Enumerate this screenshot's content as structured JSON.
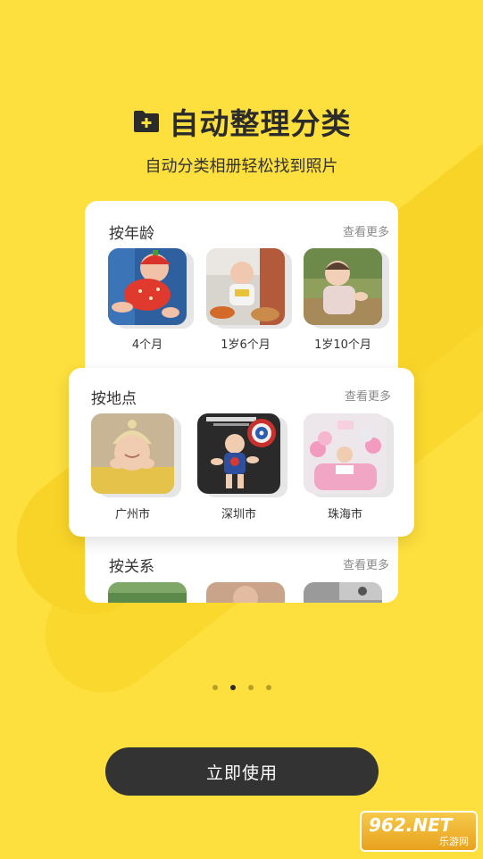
{
  "header": {
    "title": "自动整理分类",
    "subtitle": "自动分类相册轻松找到照片"
  },
  "sections": {
    "age": {
      "title": "按年龄",
      "more": "查看更多",
      "items": [
        {
          "caption": "4个月"
        },
        {
          "caption": "1岁6个月"
        },
        {
          "caption": "1岁10个月"
        }
      ]
    },
    "place": {
      "title": "按地点",
      "more": "查看更多",
      "items": [
        {
          "caption": "广州市"
        },
        {
          "caption": "深圳市"
        },
        {
          "caption": "珠海市"
        }
      ]
    },
    "relation": {
      "title": "按关系",
      "more": "查看更多"
    }
  },
  "pager": {
    "count": 4,
    "active": 2
  },
  "cta": {
    "label": "立即使用"
  },
  "watermark": {
    "top": "962.NET",
    "bottom": "乐游网"
  },
  "colors": {
    "background": "#FDDF3D",
    "button": "#333333",
    "card": "#FFFFFF"
  }
}
